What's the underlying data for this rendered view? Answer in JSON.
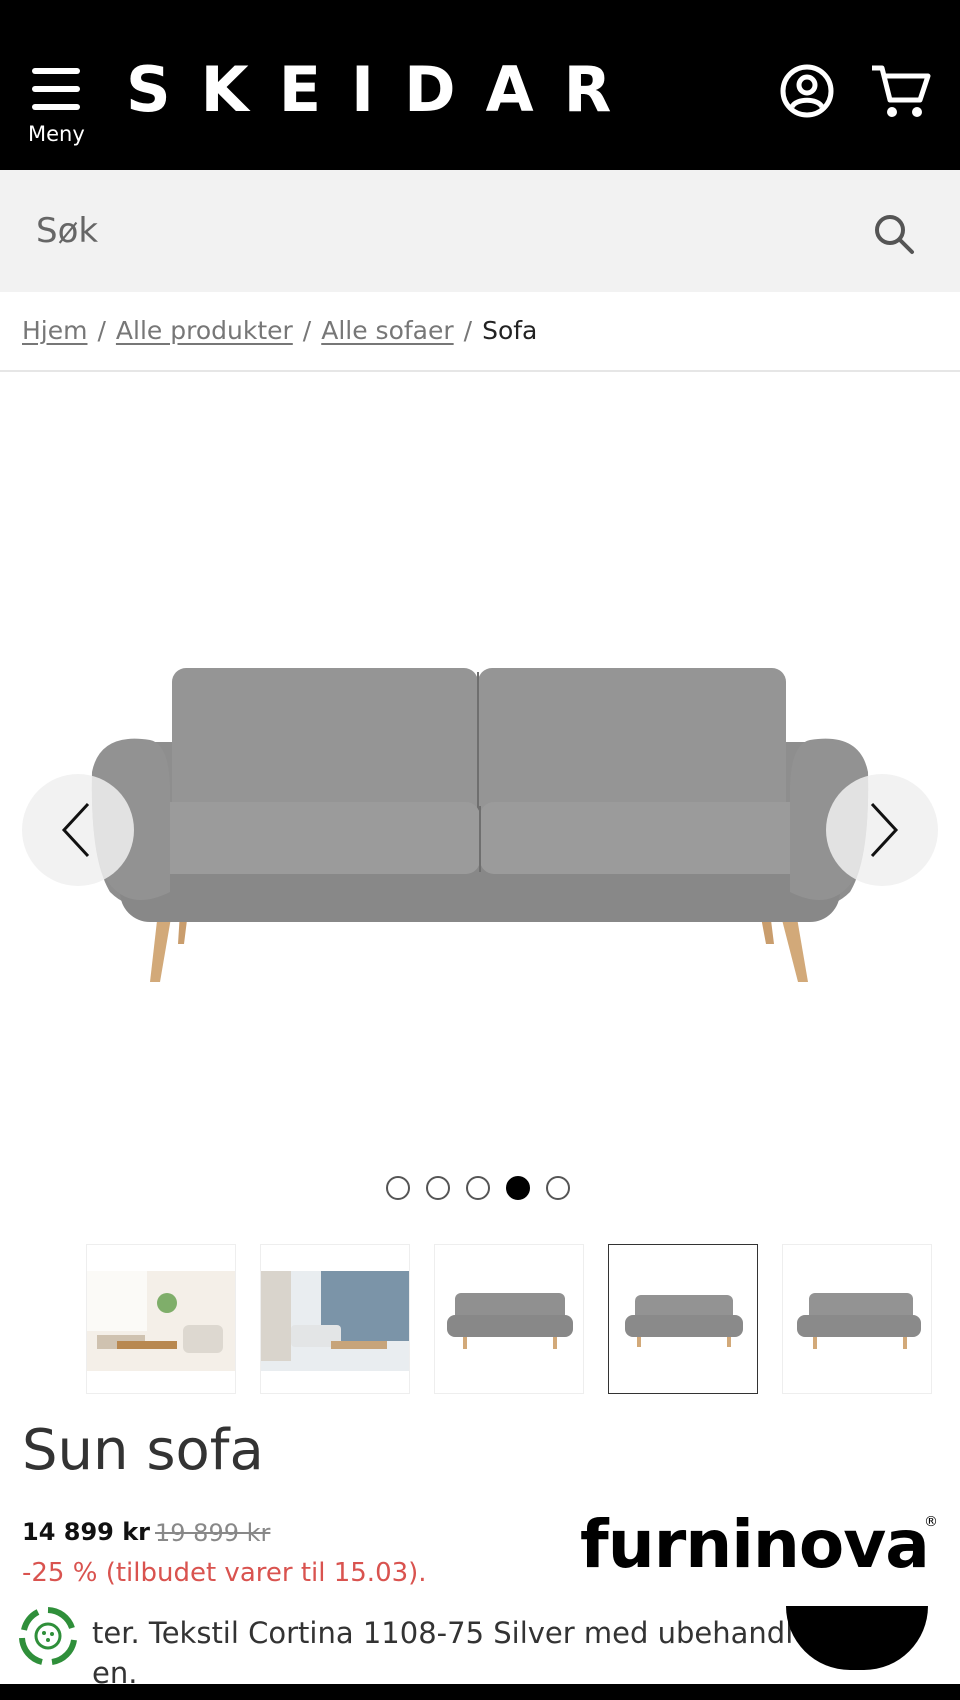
{
  "header": {
    "menu_label": "Meny",
    "logo": "SKEIDAR",
    "menu_icon": "hamburger-icon",
    "account_icon": "user-circle-icon",
    "cart_icon": "cart-icon"
  },
  "search": {
    "placeholder": "Søk",
    "icon": "search-icon"
  },
  "breadcrumb": {
    "items": [
      "Hjem",
      "Alle produkter",
      "Alle sofaer"
    ],
    "current": "Sofa",
    "separator": "/"
  },
  "gallery": {
    "slide_count": 5,
    "active_index": 3,
    "prev_icon": "chevron-left-icon",
    "next_icon": "chevron-right-icon",
    "thumbnails": [
      "living-room-scene",
      "living-room-scene-2",
      "sofa-angle",
      "sofa-front",
      "sofa-side"
    ]
  },
  "product": {
    "title": "Sun sofa",
    "price": "14 899 kr",
    "old_price": "19 899 kr",
    "discount": "-25 % (tilbudet varer til 15.03).",
    "description_line1": "ter. Tekstil Cortina 1108-75 Silver med ubehandle",
    "description_line2": "en."
  },
  "brand": {
    "name": "furninova",
    "reg": "®"
  },
  "colors": {
    "header_bg": "#000000",
    "discount": "#d9534f",
    "sofa_fabric": "#8c8c8c",
    "sofa_legs": "#d2a979",
    "eco_green": "#2f8f3a"
  }
}
